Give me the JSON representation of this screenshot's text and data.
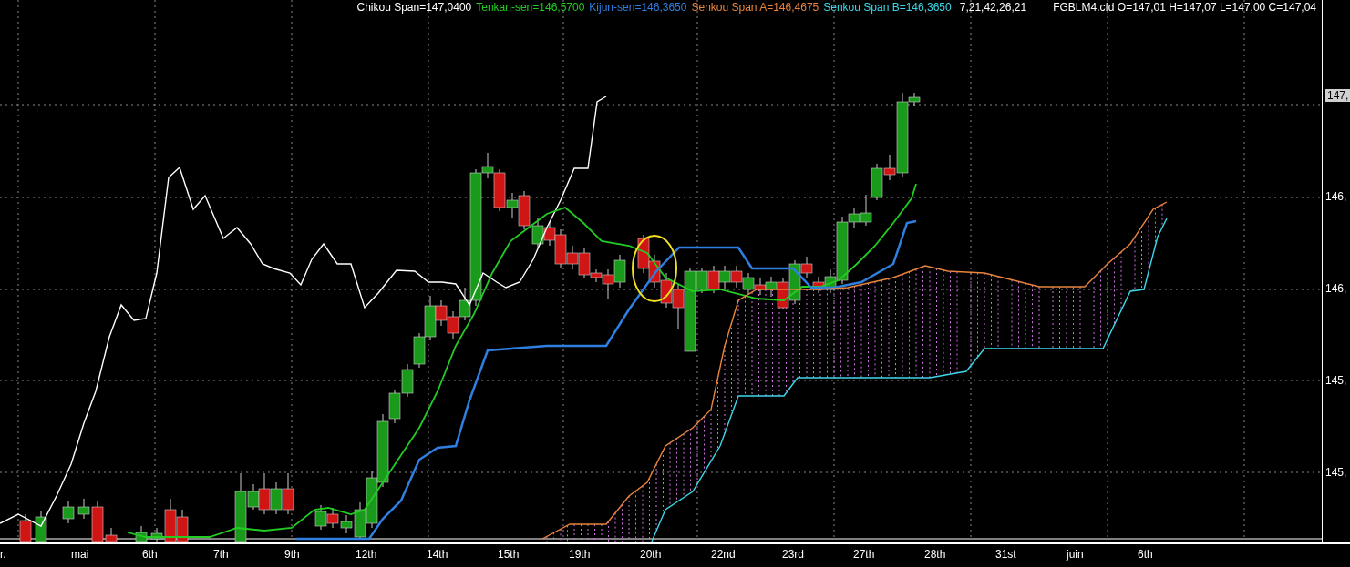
{
  "legend": {
    "series": [
      {
        "label": "Chikou Span=147,0400",
        "color": "#ffffff"
      },
      {
        "label": "Tenkan-sen=146,5700",
        "color": "#22cc22"
      },
      {
        "label": "Kijun-sen=146,3650",
        "color": "#2f7fe0"
      },
      {
        "label": "Senkou Span A=146,4675",
        "color": "#e8843c"
      },
      {
        "label": "Senkou Span B=146,3650",
        "color": "#3cd6e8"
      }
    ],
    "parameters": "7,21,42,26,21",
    "quote": "FGBLM4.cfd O=147,01 H=147,07 L=147,00 C=147,04"
  },
  "price_tag": "147,",
  "y_axis": [
    "146,",
    "146,",
    "145,",
    "145,"
  ],
  "x_axis": [
    "r.",
    "mai",
    "6th",
    "7th",
    "9th",
    "12th",
    "14th",
    "15th",
    "19th",
    "20th",
    "22nd",
    "23rd",
    "27th",
    "28th",
    "31st",
    "juin",
    "6th"
  ]
}
